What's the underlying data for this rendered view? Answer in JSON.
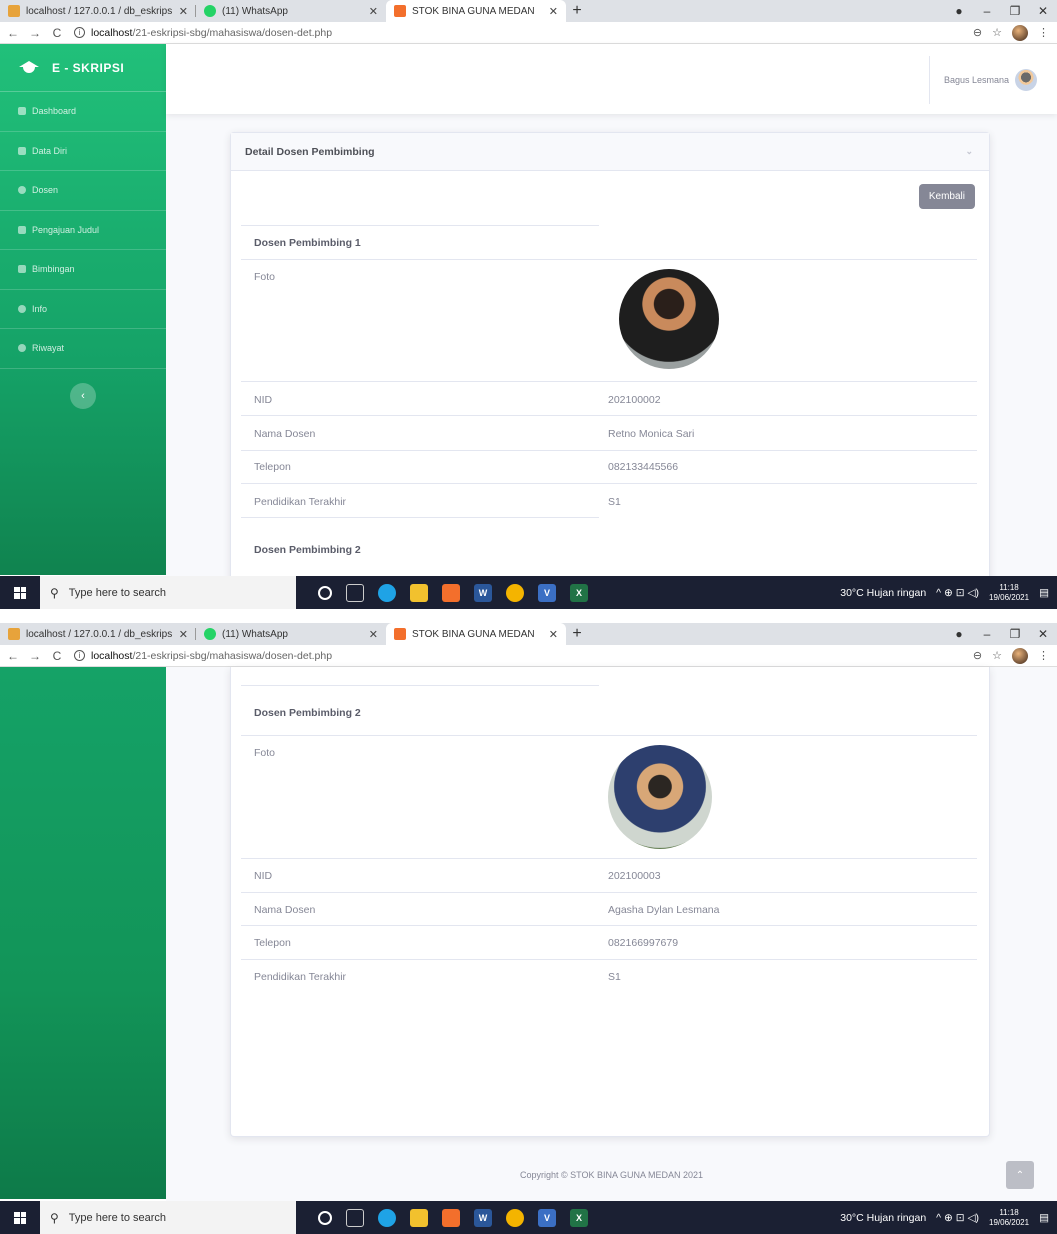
{
  "browser": {
    "tabs": [
      {
        "label": "localhost / 127.0.0.1 / db_eskrips",
        "active": false,
        "icon_color": "#e7a33b"
      },
      {
        "label": "(11) WhatsApp",
        "active": false,
        "icon_color": "#25d366"
      },
      {
        "label": "STOK BINA GUNA MEDAN",
        "active": true,
        "icon_color": "#f36f2c"
      }
    ],
    "new_tab": "+",
    "url_host": "localhost",
    "url_path": "/21-eskripsi-sbg/mahasiswa/dosen-det.php",
    "controls": {
      "minimize": "–",
      "maximize": "❐",
      "close": "✕"
    },
    "nav": {
      "back": "←",
      "forward": "→",
      "reload": "C"
    },
    "info_icon": "i",
    "zoom_icon": "⊖",
    "star_icon": "☆",
    "menu_icon": "⋮"
  },
  "sidebar": {
    "brand": "E - SKRIPSI",
    "items": [
      {
        "label": "Dashboard"
      },
      {
        "label": "Data Diri"
      },
      {
        "label": "Dosen"
      },
      {
        "label": "Pengajuan Judul"
      },
      {
        "label": "Bimbingan"
      },
      {
        "label": "Info"
      },
      {
        "label": "Riwayat"
      }
    ],
    "toggle_icon": "‹"
  },
  "topbar": {
    "user_name": "Bagus Lesmana"
  },
  "card": {
    "title": "Detail Dosen Pembimbing",
    "collapse_icon": "⌄",
    "back_button": "Kembali",
    "labels": {
      "foto": "Foto",
      "nid": "NID",
      "nama": "Nama Dosen",
      "telepon": "Telepon",
      "pendidikan": "Pendidikan Terakhir"
    },
    "pembimbing": [
      {
        "heading": "Dosen Pembimbing 1",
        "nid": "202100002",
        "nama": "Retno Monica Sari",
        "telepon": "082133445566",
        "pendidikan": "S1"
      },
      {
        "heading": "Dosen Pembimbing 2",
        "nid": "202100003",
        "nama": "Agasha Dylan Lesmana",
        "telepon": "082166997679",
        "pendidikan": "S1"
      }
    ]
  },
  "footer": {
    "copyright": "Copyright © STOK BINA GUNA MEDAN 2021",
    "to_top_icon": "⌃"
  },
  "taskbar": {
    "search_placeholder": "Type here to search",
    "weather": "30°C  Hujan ringan",
    "tray_icons": "^  ⊕  ⊡  ◁)",
    "time": "11:18",
    "date": "19/06/2021"
  }
}
